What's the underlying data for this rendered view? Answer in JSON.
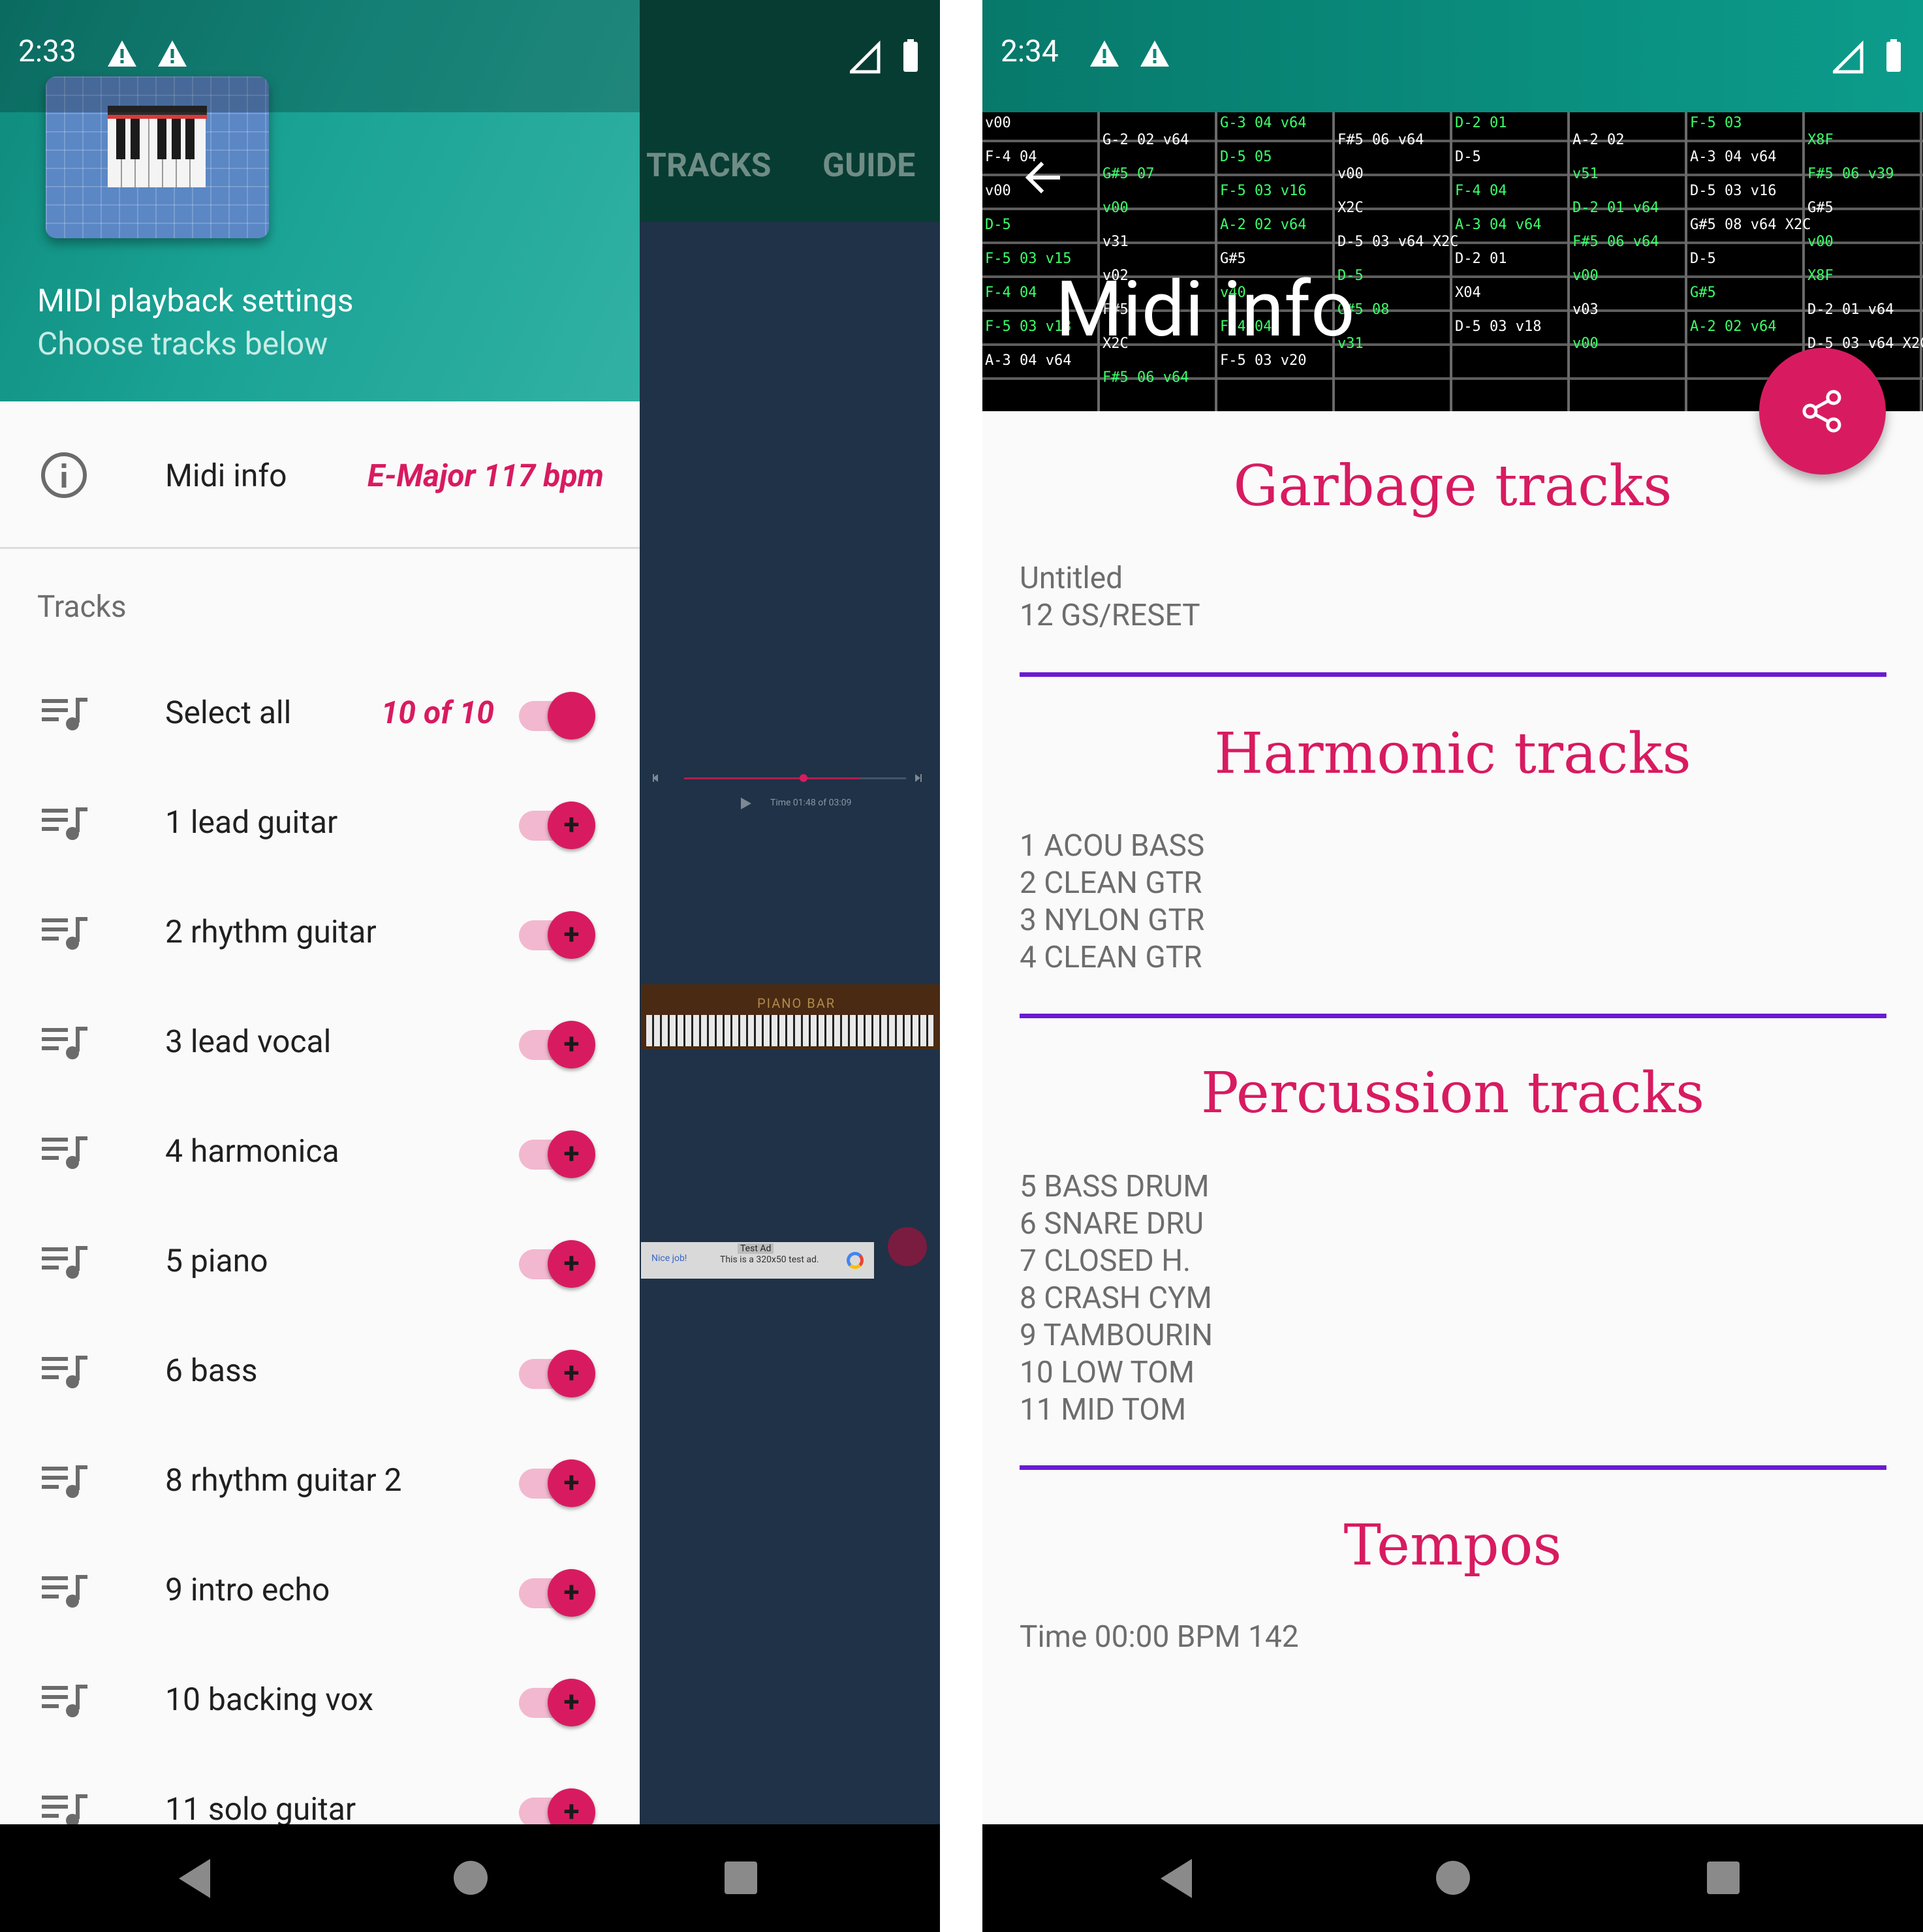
{
  "left_screen": {
    "status": {
      "time": "2:33"
    },
    "background_tabs": [
      "TRACKS",
      "GUIDE"
    ],
    "drawer": {
      "title": "MIDI playback settings",
      "subtitle": "Choose tracks below",
      "midi_info": {
        "label": "Midi info",
        "key": "E-Major 117 bpm"
      },
      "tracks_header": "Tracks",
      "select_all": {
        "label": "Select all",
        "count": "10 of 10"
      },
      "tracks": [
        {
          "label": "1 lead guitar"
        },
        {
          "label": "2 rhythm guitar"
        },
        {
          "label": "3 lead vocal"
        },
        {
          "label": "4 harmonica"
        },
        {
          "label": "5 piano"
        },
        {
          "label": "6 bass"
        },
        {
          "label": "8 rhythm guitar 2"
        },
        {
          "label": "9 intro echo"
        },
        {
          "label": "10 backing vox"
        },
        {
          "label": "11 solo guitar"
        }
      ],
      "toggle_plus": "+"
    },
    "player": {
      "time_text": "Time 01:48 of 03:09"
    },
    "keyboard_label": "PIANO BAR",
    "ad": {
      "label": "Test Ad",
      "nice": "Nice job!",
      "text": "This is a 320x50 test ad."
    }
  },
  "right_screen": {
    "status": {
      "time": "2:34"
    },
    "title": "Midi info",
    "sections": [
      {
        "title": "Garbage tracks",
        "lines": [
          "Untitled",
          "12 GS/RESET"
        ]
      },
      {
        "title": "Harmonic tracks",
        "lines": [
          "1 ACOU BASS",
          "2 CLEAN GTR",
          "3 NYLON GTR",
          "4 CLEAN GTR"
        ]
      },
      {
        "title": "Percussion tracks",
        "lines": [
          "5 BASS DRUM",
          "6 SNARE DRU",
          "7 CLOSED H.",
          "8 CRASH CYM",
          "9 TAMBOURIN",
          "10 LOW TOM",
          "11 MID TOM"
        ]
      },
      {
        "title": "Tempos",
        "lines": [
          "Time 00:00 BPM 142"
        ]
      }
    ],
    "hero_tracker_text": [
      "v00",
      "G-2 02 v64",
      "G-3 04 v64",
      "F#5 06 v64",
      "D-2 01",
      "A-2 02",
      "F-5 03",
      "X8F",
      "F-4 04",
      "G#5 07",
      "D-5 05",
      "v00",
      "D-5",
      "v51",
      "A-3 04 v64",
      "F#5 06 v39",
      "v00",
      "v00",
      "F-5 03 v16",
      "X2C",
      "F-4 04",
      "D-2 01 v64",
      "D-5 03 v16",
      "G#5",
      "D-5",
      "v31",
      "A-2 02 v64",
      "D-5 03 v64 X2C",
      "A-3 04 v64",
      "F#5 06 v64",
      "G#5 08 v64 X2C",
      "v00",
      "F-5 03 v15",
      "v02",
      "G#5",
      "D-5",
      "D-2 01",
      "v00",
      "D-5",
      "X8F",
      "F-4 04",
      "F#5",
      "v40",
      "G#5 08",
      "X04",
      "v03",
      "G#5",
      "D-2 01 v64",
      "F-5 03 v18",
      "X2C",
      "F-4 04",
      "v31",
      "D-5 03 v18",
      "v00",
      "A-2 02 v64",
      "D-5 03 v64 X2C",
      "A-3 04 v64",
      "F#5 06 v64",
      "F-5 03 v20"
    ]
  }
}
